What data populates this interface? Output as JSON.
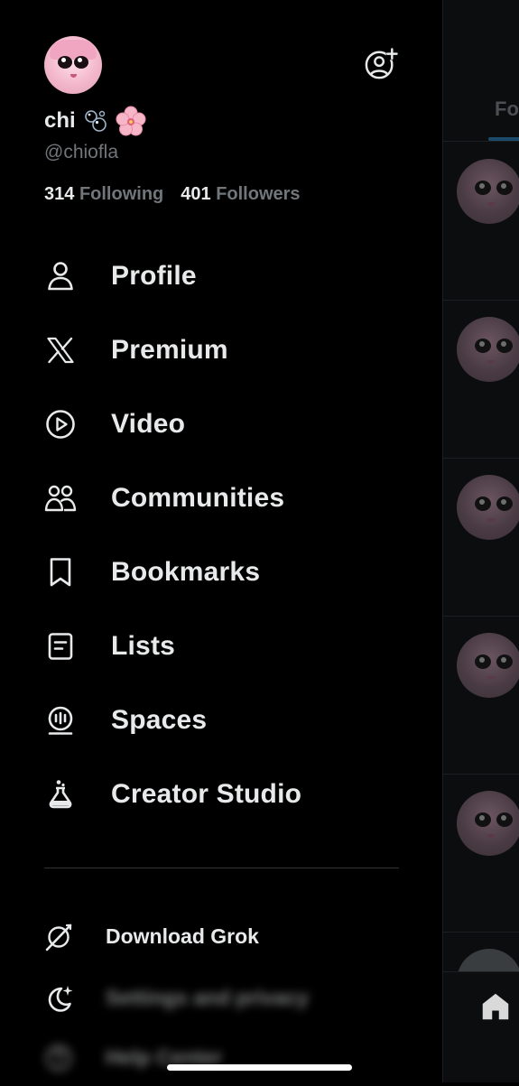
{
  "drawer": {
    "profile": {
      "display_name": "chi",
      "handle": "@chiofla",
      "following_count": "314",
      "following_label": "Following",
      "followers_count": "401",
      "followers_label": "Followers"
    },
    "menu_items": [
      {
        "label": "Profile",
        "icon": "person-icon"
      },
      {
        "label": "Premium",
        "icon": "x-logo-icon"
      },
      {
        "label": "Video",
        "icon": "play-circle-icon"
      },
      {
        "label": "Communities",
        "icon": "communities-icon"
      },
      {
        "label": "Bookmarks",
        "icon": "bookmark-icon"
      },
      {
        "label": "Lists",
        "icon": "list-icon"
      },
      {
        "label": "Spaces",
        "icon": "spaces-icon"
      },
      {
        "label": "Creator Studio",
        "icon": "flask-icon"
      }
    ],
    "secondary_items": [
      {
        "label": "Download Grok",
        "icon": "grok-icon"
      },
      {
        "label": "Settings and privacy",
        "icon": "moon-sparkle-icon"
      },
      {
        "label": "Help Center",
        "icon": "help-icon"
      }
    ]
  },
  "timeline": {
    "tab_label": "Fo"
  },
  "colors": {
    "background": "#000000",
    "text_primary": "#e7e9ea",
    "text_secondary": "#71767b",
    "divider": "#2f3336",
    "accent": "#1d9bf0"
  }
}
